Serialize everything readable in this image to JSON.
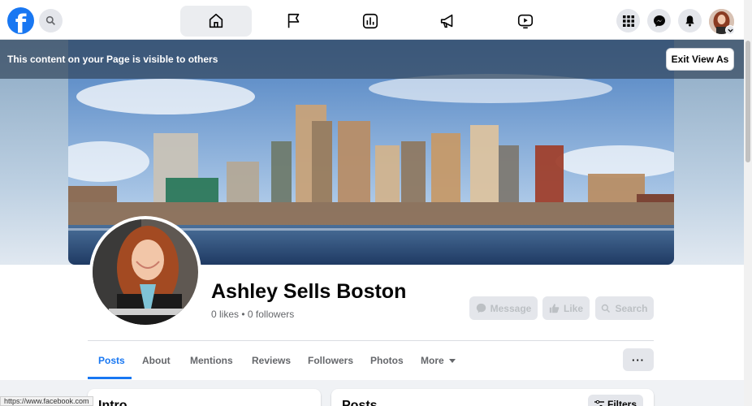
{
  "topbar": {
    "logo_letter": "f",
    "nav_tabs": [
      "home",
      "pages",
      "insights",
      "ads",
      "watch"
    ]
  },
  "notice": {
    "text": "This content on your Page is visible to others",
    "exit_label": "Exit View As"
  },
  "profile": {
    "name": "Ashley Sells Boston",
    "stats": "0 likes • 0 followers",
    "buttons": {
      "message": "Message",
      "like": "Like",
      "search": "Search"
    }
  },
  "tabs": {
    "posts": "Posts",
    "about": "About",
    "mentions": "Mentions",
    "reviews": "Reviews",
    "followers": "Followers",
    "photos": "Photos",
    "more": "More"
  },
  "more_button": "···",
  "intro": {
    "title": "Intro"
  },
  "posts": {
    "title": "Posts",
    "filters_label": "Filters"
  },
  "status_url": "https://www.facebook.com",
  "colors": {
    "brand": "#1877f2",
    "notice_bg": "#34485e",
    "disabled_btn": "#e4e6eb"
  },
  "icons": [
    "search-icon",
    "home-icon",
    "flag-icon",
    "insights-icon",
    "megaphone-icon",
    "watch-icon",
    "menu-grid-icon",
    "messenger-icon",
    "bell-icon",
    "chevron-down-icon",
    "message-icon",
    "thumbs-up-icon",
    "search-icon",
    "filters-icon"
  ]
}
